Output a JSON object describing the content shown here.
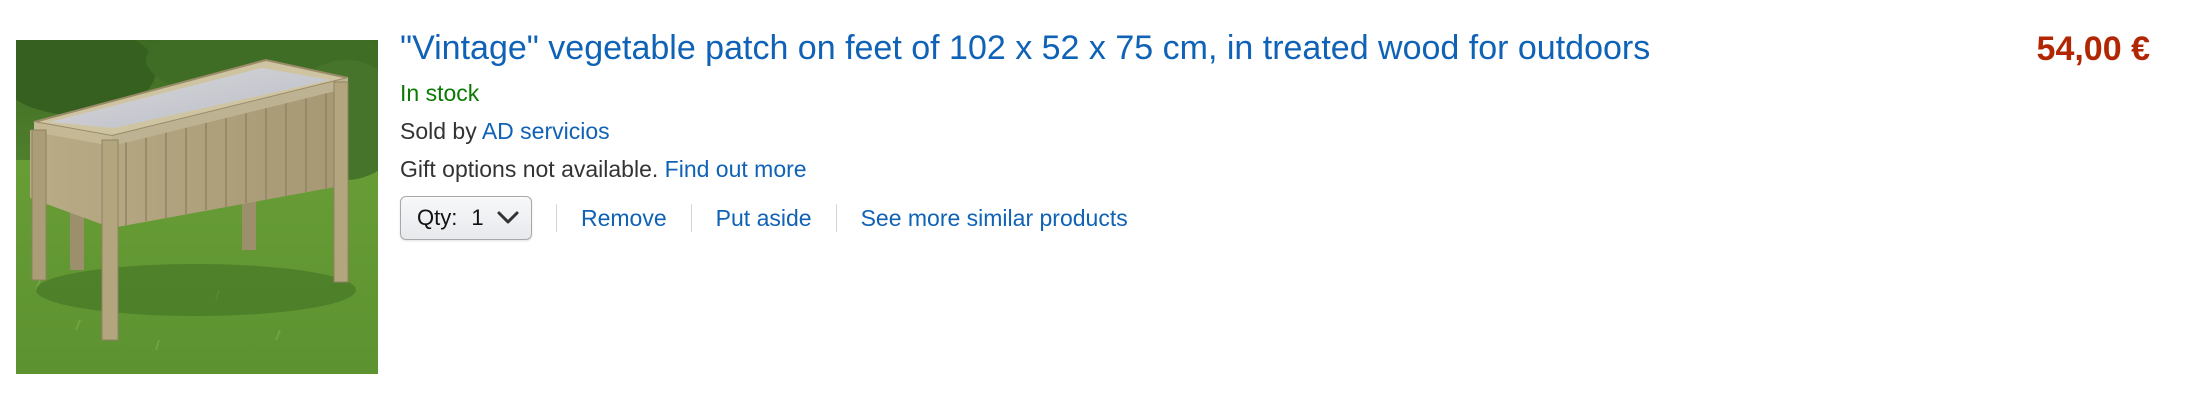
{
  "item": {
    "title": "\"Vintage\" vegetable patch on feet of 102 x 52 x 75 cm, in treated wood for outdoors",
    "image_alt": "Raised wooden vegetable planter on legs standing on grass",
    "stock": "In stock",
    "sold_by_prefix": "Sold by",
    "seller": "AD servicios",
    "gift_text": "Gift options not available.",
    "gift_link": "Find out more",
    "price": "54,00 €"
  },
  "actions": {
    "qty_label": "Qty:",
    "qty_value": "1",
    "remove": "Remove",
    "put_aside": "Put aside",
    "similar": "See more similar products"
  },
  "colors": {
    "link": "#0f62b5",
    "stock": "#0a7a00",
    "price": "#b12704"
  }
}
